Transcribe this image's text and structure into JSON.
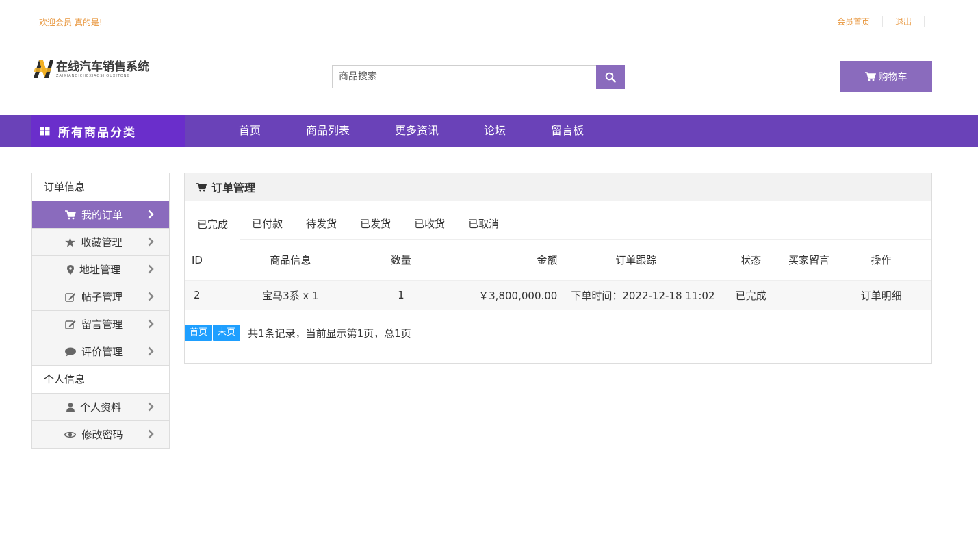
{
  "topbar": {
    "welcome": "欢迎会员 真的是!",
    "links": [
      "会员首页",
      "退出"
    ]
  },
  "header": {
    "logo_title": "在线汽车销售系统",
    "logo_sub": "ZAIXIANQICHEXIAOSHOUXITONG",
    "search_placeholder": "商品搜索",
    "cart_label": "购物车"
  },
  "nav": {
    "all_label": "所有商品分类",
    "items": [
      "首页",
      "商品列表",
      "更多资讯",
      "论坛",
      "留言板"
    ]
  },
  "sidebar": {
    "sections": [
      {
        "title": "订单信息",
        "items": [
          {
            "label": "我的订单",
            "icon": "cart-icon",
            "active": true
          },
          {
            "label": "收藏管理",
            "icon": "star-icon"
          },
          {
            "label": "地址管理",
            "icon": "map-marker-icon"
          },
          {
            "label": "帖子管理",
            "icon": "edit-icon"
          },
          {
            "label": "留言管理",
            "icon": "edit-icon"
          },
          {
            "label": "评价管理",
            "icon": "comment-icon"
          }
        ]
      },
      {
        "title": "个人信息",
        "items": [
          {
            "label": "个人资料",
            "icon": "user-icon"
          },
          {
            "label": "修改密码",
            "icon": "eye-icon"
          }
        ]
      }
    ]
  },
  "panel": {
    "title": "订单管理",
    "tabs": [
      "已完成",
      "已付款",
      "待发货",
      "已发货",
      "已收货",
      "已取消"
    ],
    "active_tab": "已完成",
    "columns": [
      "ID",
      "商品信息",
      "数量",
      "金额",
      "订单跟踪",
      "状态",
      "买家留言",
      "操作"
    ],
    "rows": [
      {
        "id": "2",
        "product": "宝马3系 x 1",
        "qty": "1",
        "amount": "￥3,800,000.00",
        "tracking": "下单时间：2022-12-18 11:02",
        "status": "已完成",
        "note": "",
        "action": "订单明细"
      }
    ],
    "pager": {
      "first": "首页",
      "last": "末页",
      "info": "共1条记录，当前显示第1页，总1页"
    }
  },
  "colors": {
    "accent": "#8a6bbd",
    "nav": "#6a42b8",
    "nav_all": "#6a2ecb",
    "link": "#e8963c",
    "pager": "#1e9fff"
  }
}
